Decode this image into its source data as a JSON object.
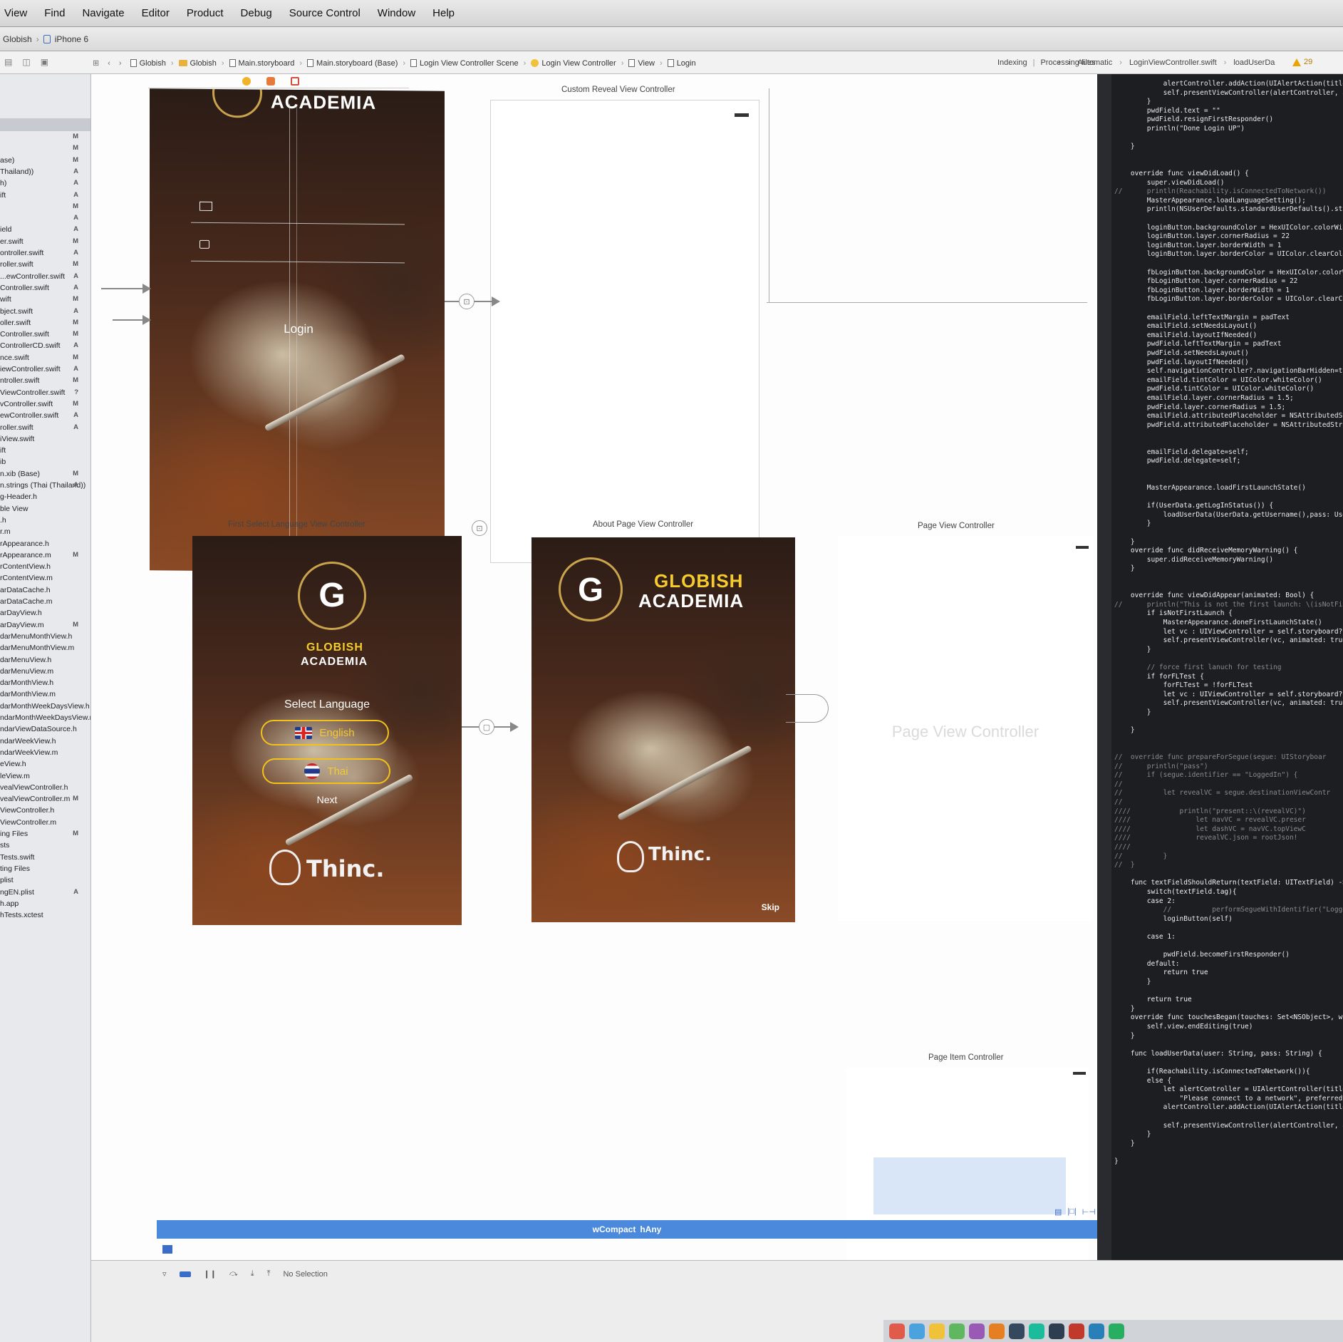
{
  "menubar": {
    "items": [
      "View",
      "Find",
      "Navigate",
      "Editor",
      "Product",
      "Debug",
      "Source Control",
      "Window",
      "Help"
    ]
  },
  "toolbar": {
    "scheme": "Globish",
    "device": "iPhone 6"
  },
  "jumpbar": {
    "breadcrumb": [
      "Globish",
      "Globish",
      "Main.storyboard",
      "Main.storyboard (Base)",
      "Login View Controller Scene",
      "Login View Controller",
      "View",
      "Login"
    ],
    "activity_left": "Indexing",
    "activity_right": "Processing files",
    "warning_count": "29",
    "assistant_mode": "Automatic",
    "assistant_file": "LoginViewController.swift",
    "assistant_method": "loadUserDa"
  },
  "navigator": {
    "rows": [
      {
        "name": "",
        "status": "M"
      },
      {
        "name": "",
        "status": "M"
      },
      {
        "name": "ase)",
        "status": "M"
      },
      {
        "name": "Thailand))",
        "status": "A"
      },
      {
        "name": "h)",
        "status": "A"
      },
      {
        "name": "ift",
        "status": "A"
      },
      {
        "name": "",
        "status": "M"
      },
      {
        "name": "",
        "status": "A"
      },
      {
        "name": "ield",
        "status": "A"
      },
      {
        "name": "er.swift",
        "status": "M"
      },
      {
        "name": "ontroller.swift",
        "status": "A"
      },
      {
        "name": "roller.swift",
        "status": "M"
      },
      {
        "name": "...ewController.swift",
        "status": "A"
      },
      {
        "name": "Controller.swift",
        "status": "A"
      },
      {
        "name": "wift",
        "status": "M"
      },
      {
        "name": "bject.swift",
        "status": "A"
      },
      {
        "name": "oller.swift",
        "status": "M"
      },
      {
        "name": "Controller.swift",
        "status": "M"
      },
      {
        "name": "ControllerCD.swift",
        "status": "A"
      },
      {
        "name": "nce.swift",
        "status": "M"
      },
      {
        "name": "iewController.swift",
        "status": "A"
      },
      {
        "name": "ntroller.swift",
        "status": "M"
      },
      {
        "name": "ViewController.swift",
        "status": "?"
      },
      {
        "name": "vController.swift",
        "status": "M"
      },
      {
        "name": "ewController.swift",
        "status": "A"
      },
      {
        "name": "roller.swift",
        "status": "A"
      },
      {
        "name": "iView.swift",
        "status": ""
      },
      {
        "name": "ift",
        "status": ""
      },
      {
        "name": "ib",
        "status": ""
      },
      {
        "name": "n.xib (Base)",
        "status": "M"
      },
      {
        "name": "n.strings (Thai (Thailand))",
        "status": "A"
      },
      {
        "name": "g-Header.h",
        "status": ""
      },
      {
        "name": "ble View",
        "status": ""
      },
      {
        "name": ".h",
        "status": ""
      },
      {
        "name": "r.m",
        "status": ""
      },
      {
        "name": "rAppearance.h",
        "status": ""
      },
      {
        "name": "rAppearance.m",
        "status": "M"
      },
      {
        "name": "rContentView.h",
        "status": ""
      },
      {
        "name": "rContentView.m",
        "status": ""
      },
      {
        "name": "arDataCache.h",
        "status": ""
      },
      {
        "name": "arDataCache.m",
        "status": ""
      },
      {
        "name": "arDayView.h",
        "status": ""
      },
      {
        "name": "arDayView.m",
        "status": "M"
      },
      {
        "name": "darMenuMonthView.h",
        "status": ""
      },
      {
        "name": "darMenuMonthView.m",
        "status": ""
      },
      {
        "name": "darMenuView.h",
        "status": ""
      },
      {
        "name": "darMenuView.m",
        "status": ""
      },
      {
        "name": "darMonthView.h",
        "status": ""
      },
      {
        "name": "darMonthView.m",
        "status": ""
      },
      {
        "name": "darMonthWeekDaysView.h",
        "status": ""
      },
      {
        "name": "ndarMonthWeekDaysView.m",
        "status": ""
      },
      {
        "name": "ndarViewDataSource.h",
        "status": ""
      },
      {
        "name": "ndarWeekView.h",
        "status": ""
      },
      {
        "name": "ndarWeekView.m",
        "status": ""
      },
      {
        "name": "eView.h",
        "status": ""
      },
      {
        "name": "leView.m",
        "status": ""
      },
      {
        "name": "vealViewController.h",
        "status": ""
      },
      {
        "name": "vealViewController.m",
        "status": "M"
      },
      {
        "name": "ViewController.h",
        "status": ""
      },
      {
        "name": "ViewController.m",
        "status": ""
      },
      {
        "name": "ing Files",
        "status": "M"
      },
      {
        "name": "sts",
        "status": ""
      },
      {
        "name": "Tests.swift",
        "status": ""
      },
      {
        "name": "ting Files",
        "status": ""
      },
      {
        "name": "plist",
        "status": ""
      },
      {
        "name": "ngEN.plist",
        "status": "A"
      },
      {
        "name": "h.app",
        "status": ""
      },
      {
        "name": "hTests.xctest",
        "status": ""
      }
    ]
  },
  "canvas": {
    "login_scene": {
      "brand": "ACADEMIA",
      "login_label": "Login"
    },
    "custom_reveal": {
      "title": "Custom Reveal View Controller"
    },
    "first_select": {
      "title": "First Select Language View Controller",
      "brand_top": "GLOBISH",
      "brand_bottom": "ACADEMIA",
      "select_label": "Select Language",
      "english": "English",
      "thai": "Thai",
      "next": "Next",
      "thinc": "Thinc."
    },
    "about_page": {
      "title": "About Page View Controller",
      "brand_top": "GLOBISH",
      "brand_bottom": "ACADEMIA",
      "thinc": "Thinc.",
      "skip": "Skip"
    },
    "page_vc": {
      "title": "Page View Controller",
      "placeholder": "Page View Controller"
    },
    "page_item": {
      "title": "Page Item Controller"
    }
  },
  "code": {
    "lines": [
      "            alertController.addAction(UIAlertAction(title:",
      "            self.presentViewController(alertController, an",
      "        }",
      "        pwdField.text = \"\"",
      "        pwdField.resignFirstResponder()",
      "        println(\"Done Login UP\")",
      "",
      "    }",
      "",
      "",
      "    override func viewDidLoad() {",
      "        super.viewDidLoad()",
      "//      println(Reachability.isConnectedToNetwork())",
      "        MasterAppearance.loadLanguageSetting();",
      "        println(NSUserDefaults.standardUserDefaults().strin",
      "",
      "        loginButton.backgroundColor = HexUIColor.colorWith",
      "        loginButton.layer.cornerRadius = 22",
      "        loginButton.layer.borderWidth = 1",
      "        loginButton.layer.borderColor = UIColor.clearColor",
      "",
      "        fbLoginButton.backgroundColor = HexUIColor.colorWi",
      "        fbLoginButton.layer.cornerRadius = 22",
      "        fbLoginButton.layer.borderWidth = 1",
      "        fbLoginButton.layer.borderColor = UIColor.clearColo",
      "",
      "        emailField.leftTextMargin = padText",
      "        emailField.setNeedsLayout()",
      "        emailField.layoutIfNeeded()",
      "        pwdField.leftTextMargin = padText",
      "        pwdField.setNeedsLayout()",
      "        pwdField.layoutIfNeeded()",
      "        self.navigationController?.navigationBarHidden=tru",
      "        emailField.tintColor = UIColor.whiteColor()",
      "        pwdField.tintColor = UIColor.whiteColor()",
      "        emailField.layer.cornerRadius = 1.5;",
      "        pwdField.layer.cornerRadius = 1.5;",
      "        emailField.attributedPlaceholder = NSAttributedStri",
      "        pwdField.attributedPlaceholder = NSAttributedStrin",
      "",
      "",
      "        emailField.delegate=self;",
      "        pwdField.delegate=self;",
      "",
      "",
      "        MasterAppearance.loadFirstLaunchState()",
      "",
      "        if(UserData.getLogInStatus()) {",
      "            loadUserData(UserData.getUsername(),pass: User",
      "        }",
      "",
      "    }",
      "    override func didReceiveMemoryWarning() {",
      "        super.didReceiveMemoryWarning()",
      "    }",
      "",
      "",
      "    override func viewDidAppear(animated: Bool) {",
      "//      println(\"This is not the first launch: \\(isNotFi",
      "        if isNotFirstLaunch {",
      "            MasterAppearance.doneFirstLaunchState()",
      "            let vc : UIViewController = self.storyboard?.in",
      "            self.presentViewController(vc, animated: true,",
      "        }",
      "",
      "        // force first lanuch for testing",
      "        if forFLTest {",
      "            forFLTest = !forFLTest",
      "            let vc : UIViewController = self.storyboard?.in",
      "            self.presentViewController(vc, animated: true,",
      "        }",
      "",
      "    }",
      "",
      "",
      "//  override func prepareForSegue(segue: UIStoryboar",
      "//      println(\"pass\")",
      "//      if (segue.identifier == \"LoggedIn\") {",
      "//",
      "//          let revealVC = segue.destinationViewContr",
      "//",
      "////            println(\"present::\\(revealVC)\")",
      "////                let navVC = revealVC.preser",
      "////                let dashVC = navVC.topViewC",
      "////                revealVC.json = rootJson!",
      "////",
      "//          }",
      "//  }",
      "",
      "    func textFieldShouldReturn(textField: UITextField) -> B",
      "        switch(textField.tag){",
      "        case 2:",
      "            //          performSegueWithIdentifier(\"Logge",
      "            loginButton(self)",
      "",
      "        case 1:",
      "",
      "            pwdField.becomeFirstResponder()",
      "        default:",
      "            return true",
      "        }",
      "",
      "        return true",
      "    }",
      "    override func touchesBegan(touches: Set<NSObject>, with",
      "        self.view.endEditing(true)",
      "    }",
      "",
      "    func loadUserData(user: String, pass: String) {",
      "",
      "        if(Reachability.isConnectedToNetwork()){",
      "        else {",
      "            let alertController = UIAlertController(title:",
      "                \"Please connect to a network\", preferredSty",
      "            alertController.addAction(UIAlertAction(title:",
      "",
      "            self.presentViewController(alertController, an",
      "        }",
      "    }",
      "",
      "}"
    ]
  },
  "bottom": {
    "size_class_w": "wCompact",
    "size_class_h": "hAny",
    "debug_status": "No Selection"
  },
  "colors": {
    "brand_yellow": "#f5cc2c",
    "logo_gold": "#c9a44c",
    "size_class_blue": "#4a89dc",
    "code_bg": "#1d1e22"
  }
}
